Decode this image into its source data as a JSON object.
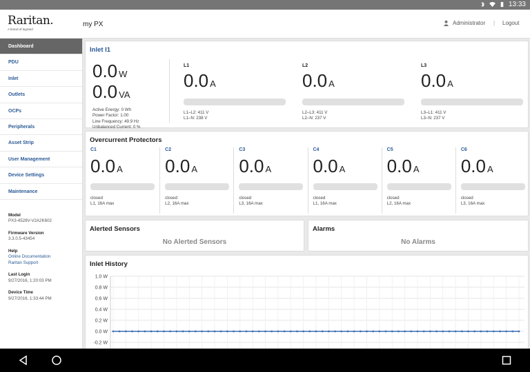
{
  "status_bar": {
    "time": "13:33",
    "icons": [
      "bluetooth-icon",
      "wifi-icon",
      "battery-icon"
    ]
  },
  "header": {
    "logo_text": "Raritan.",
    "logo_sub": "A brand of legrand",
    "device_name": "my PX",
    "user": "Administrator",
    "separator": "|",
    "logout": "Logout"
  },
  "sidebar": {
    "items": [
      {
        "label": "Dashboard",
        "active": true
      },
      {
        "label": "PDU"
      },
      {
        "label": "Inlet"
      },
      {
        "label": "Outlets"
      },
      {
        "label": "OCPs"
      },
      {
        "label": "Peripherals"
      },
      {
        "label": "Asset Strip"
      },
      {
        "label": "User Management"
      },
      {
        "label": "Device Settings"
      },
      {
        "label": "Maintenance"
      }
    ],
    "model_label": "Model",
    "model_value": "PX3-4528V-V2A2K602",
    "firmware_label": "Firmware Version",
    "firmware_value": "3.3.0.5-43454",
    "help_label": "Help",
    "help_link1": "Online Documentation",
    "help_link2": "Raritan Support",
    "last_login_label": "Last Login",
    "last_login_value": "9/27/2016, 1:20:03 PM",
    "device_time_label": "Device Time",
    "device_time_value": "9/27/2016, 1:33:44 PM"
  },
  "inlet": {
    "title": "Inlet I1",
    "power_value": "0.0",
    "power_unit": "W",
    "apparent_value": "0.0",
    "apparent_unit": "VA",
    "details": [
      "Active Energy: 0 Wh",
      "Power Factor: 1.00",
      "Line Frequency: 49.9 Hz",
      "Unbalanced Current: 0 %"
    ],
    "lines": [
      {
        "label": "L1",
        "value": "0.0",
        "unit": "A",
        "v1": "L1–L2: 411 V",
        "v2": "L1–N: 238 V"
      },
      {
        "label": "L2",
        "value": "0.0",
        "unit": "A",
        "v1": "L2–L3: 411 V",
        "v2": "L2–N: 237 V"
      },
      {
        "label": "L3",
        "value": "0.0",
        "unit": "A",
        "v1": "L3–L1: 411 V",
        "v2": "L3–N: 237 V"
      }
    ]
  },
  "ocp": {
    "title": "Overcurrent Protectors",
    "items": [
      {
        "label": "C1",
        "value": "0.0",
        "unit": "A",
        "state": "closed",
        "rating": "L1, 16A max"
      },
      {
        "label": "C2",
        "value": "0.0",
        "unit": "A",
        "state": "closed",
        "rating": "L2, 16A max"
      },
      {
        "label": "C3",
        "value": "0.0",
        "unit": "A",
        "state": "closed",
        "rating": "L3, 16A max"
      },
      {
        "label": "C4",
        "value": "0.0",
        "unit": "A",
        "state": "closed",
        "rating": "L1, 16A max"
      },
      {
        "label": "C5",
        "value": "0.0",
        "unit": "A",
        "state": "closed",
        "rating": "L2, 16A max"
      },
      {
        "label": "C6",
        "value": "0.0",
        "unit": "A",
        "state": "closed",
        "rating": "L3, 16A max"
      }
    ]
  },
  "alerted": {
    "title": "Alerted Sensors",
    "empty": "No Alerted Sensors"
  },
  "alarms": {
    "title": "Alarms",
    "empty": "No Alarms"
  },
  "history": {
    "title": "Inlet History"
  },
  "chart_data": {
    "type": "line",
    "title": "",
    "xlabel": "",
    "ylabel": "",
    "y_tick_labels": [
      "1.0 W",
      "0.8 W",
      "0.6 W",
      "0.4 W",
      "0.2 W",
      "0.0 W",
      "-0.2 W"
    ],
    "ylim": [
      -0.2,
      1.0
    ],
    "series": [
      {
        "values": [
          0,
          0,
          0,
          0,
          0,
          0,
          0,
          0,
          0,
          0,
          0,
          0,
          0,
          0,
          0,
          0,
          0,
          0,
          0,
          0,
          0,
          0,
          0,
          0,
          0,
          0,
          0,
          0,
          0,
          0,
          0,
          0,
          0,
          0,
          0,
          0,
          0,
          0,
          0,
          0,
          0,
          0,
          0,
          0,
          0,
          0,
          0,
          0,
          0,
          0,
          0,
          0,
          0,
          0,
          0,
          0,
          0,
          0,
          0,
          0,
          0,
          0,
          0,
          0,
          0
        ]
      }
    ],
    "color": "#3a6fb5",
    "grid": true
  }
}
